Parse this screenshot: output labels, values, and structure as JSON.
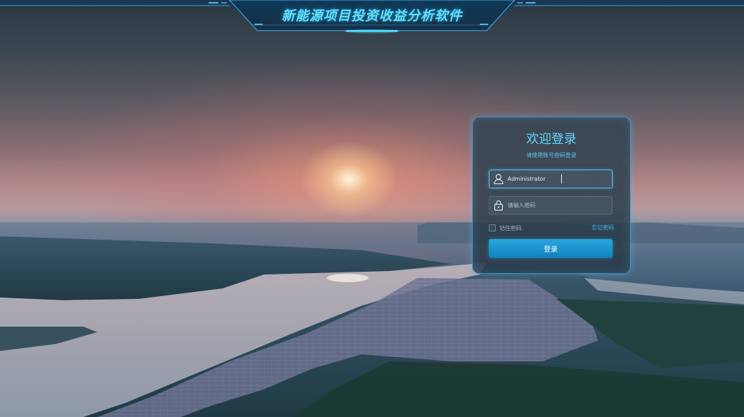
{
  "header": {
    "title": "新能源项目投资收益分析软件"
  },
  "login": {
    "title": "欢迎登录",
    "subtitle": "请使用账号密码登录",
    "username": {
      "value": "Administrator",
      "icon": "user-icon"
    },
    "password": {
      "placeholder": "请输入密码",
      "icon": "lock-icon"
    },
    "remember_label": "记住密码",
    "remember_checked": false,
    "forgot_label": "忘记密码",
    "submit_label": "登录"
  },
  "colors": {
    "accent": "#5fe0ff",
    "button": "#1b93cf"
  }
}
